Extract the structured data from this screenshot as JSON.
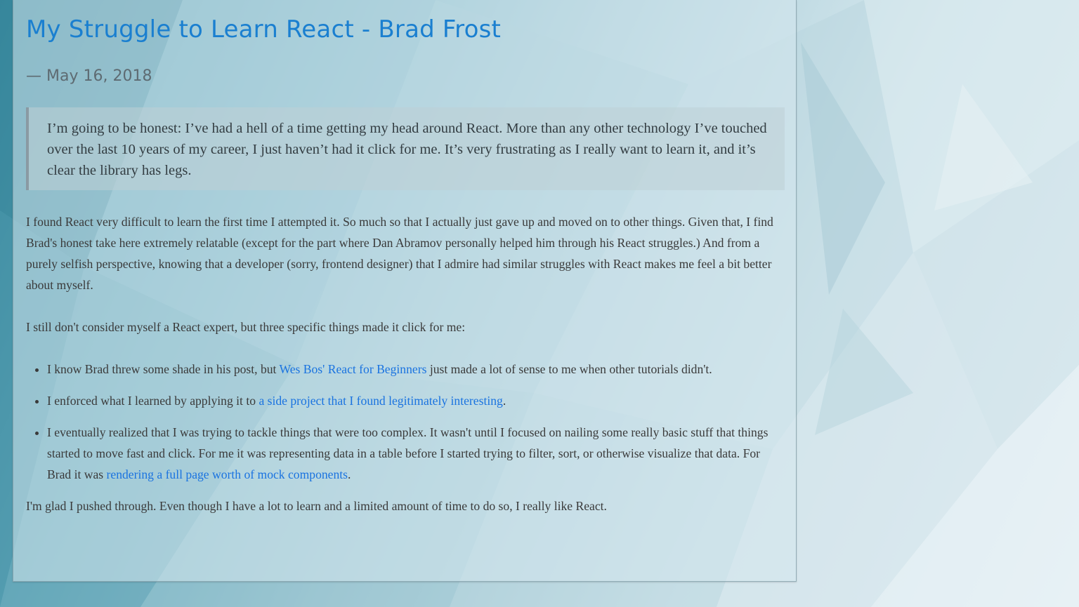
{
  "post": {
    "title": "My Struggle to Learn React - Brad Frost",
    "date": "— May 16, 2018",
    "quote": "I’m going to be honest: I’ve had a hell of a time getting my head around React. More than any other technology I’ve touched over the last 10 years of my career, I just haven’t had it click for me. It’s very frustrating as I really want to learn it, and it’s clear the library has legs.",
    "paragraph1": "I found React very difficult to learn the first time I attempted it. So much so that I actually just gave up and moved on to other things. Given that, I find Brad's honest take here extremely relatable (except for the part where Dan Abramov personally helped him through his React struggles.) And from a purely selfish perspective, knowing that a developer (sorry, frontend designer) that I admire had similar struggles with React makes me feel a bit better about myself.",
    "paragraph2": "I still don't consider myself a React expert, but three specific things made it click for me:",
    "list": [
      {
        "before": "I know Brad threw some shade in his post, but ",
        "link": "Wes Bos' React for Beginners",
        "after": " just made a lot of sense to me when other tutorials didn't."
      },
      {
        "before": "I enforced what I learned by applying it to ",
        "link": "a side project that I found legitimately interesting",
        "after": "."
      },
      {
        "before": "I eventually realized that I was trying to tackle things that were too complex. It wasn't until I focused on nailing some really basic stuff that things started to move fast and click. For me it was representing data in a table before I started trying to filter, sort, or otherwise visualize that data. For Brad it was ",
        "link": "rendering a full page worth of mock components",
        "after": "."
      }
    ],
    "paragraph3": "I'm glad I pushed through. Even though I have a lot to learn and a limited amount of time to do so, I really like React."
  },
  "colors": {
    "link": "#1a73e0",
    "title": "#1a7fd0",
    "text": "#3a3a3a",
    "date": "#5e6b72"
  }
}
